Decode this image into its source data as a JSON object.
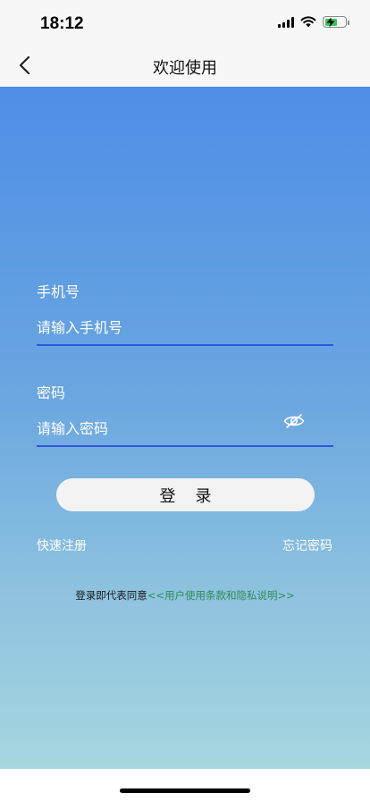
{
  "status_bar": {
    "time": "18:12",
    "icons": [
      "signal-icon",
      "wifi-icon",
      "battery-charging-icon"
    ]
  },
  "nav": {
    "back_icon": "chevron-left-icon",
    "title": "欢迎使用"
  },
  "form": {
    "phone": {
      "label": "手机号",
      "placeholder": "请输入手机号",
      "value": ""
    },
    "password": {
      "label": "密码",
      "placeholder": "请输入密码",
      "value": "",
      "toggle_icon": "eye-icon"
    },
    "login_label": "登录",
    "register_label": "快速注册",
    "forgot_label": "忘记密码",
    "agreement_text": "登录即代表同意",
    "agreement_link": "<<用户使用条款和隐私说明>>"
  },
  "colors": {
    "gradient_top": "#4e8ee6",
    "gradient_bottom": "#a6d6df",
    "underline": "#2f55d6",
    "agreement_link": "#2e8b57"
  }
}
